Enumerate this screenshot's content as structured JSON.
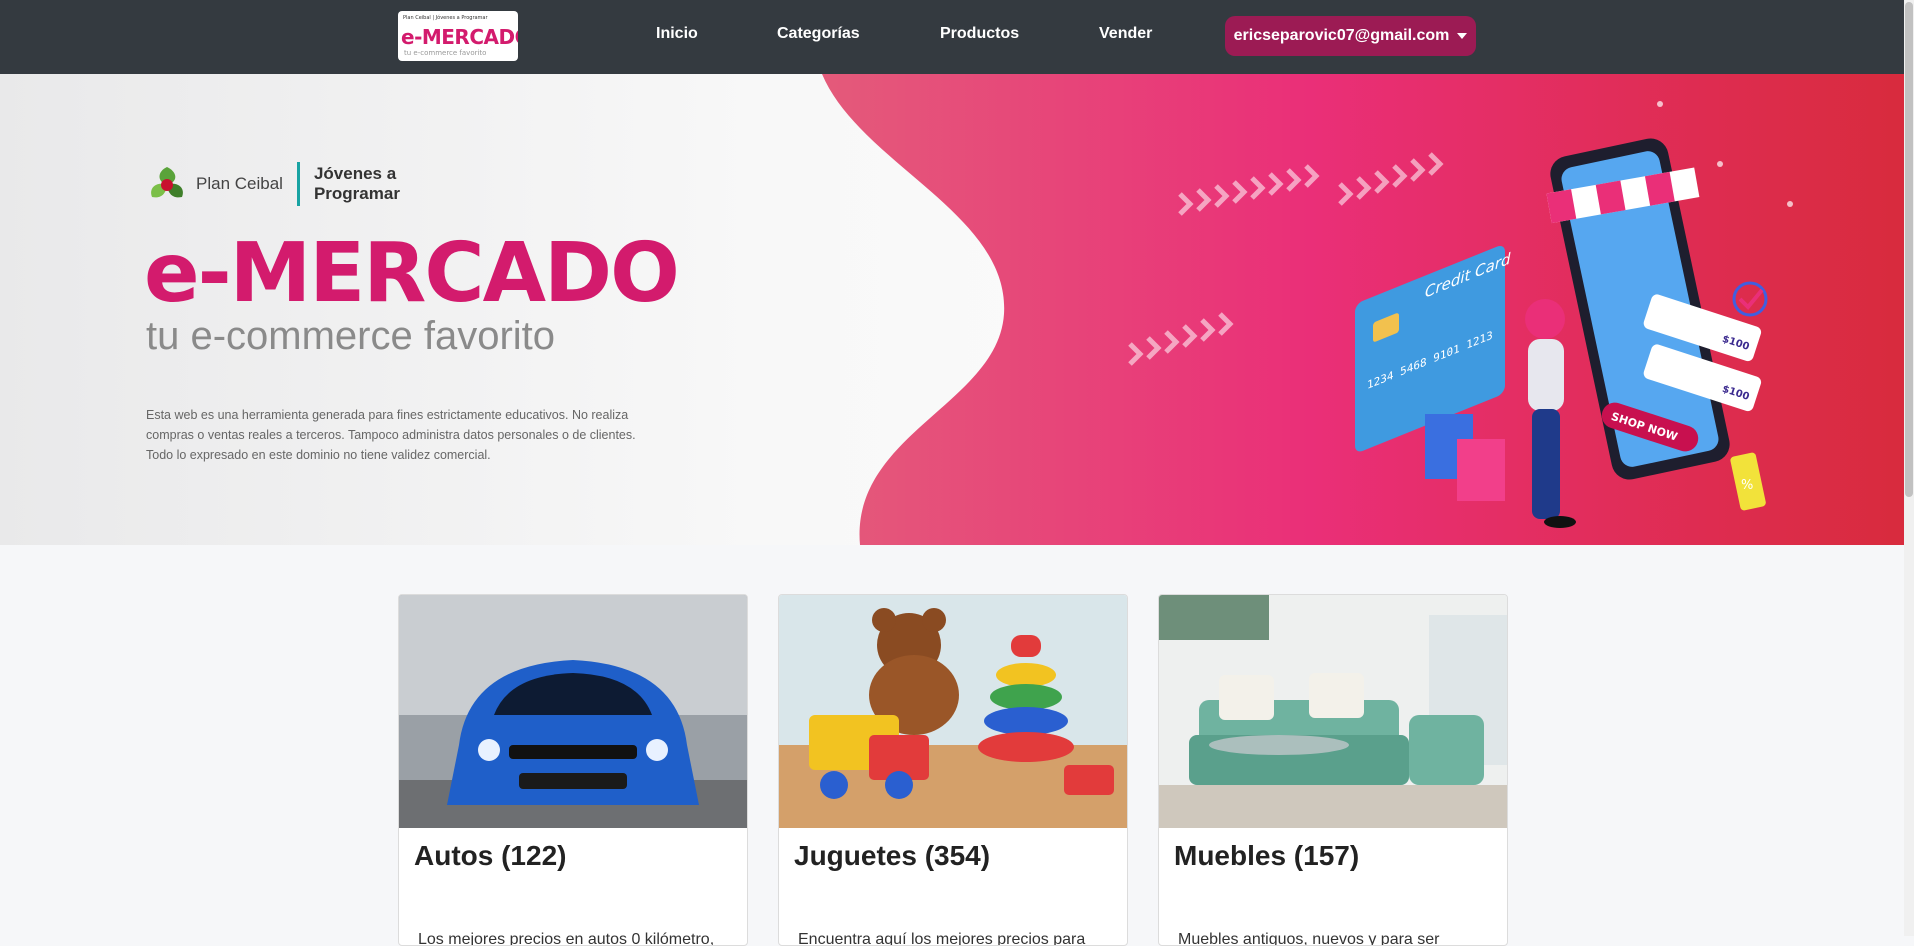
{
  "navbar": {
    "logo": {
      "top_small": "Plan Ceibal | Jóvenes a Programar",
      "title": "e-MERCADO",
      "tagline": "tu e-commerce favorito"
    },
    "links": [
      "Inicio",
      "Categorías",
      "Productos",
      "Vender"
    ],
    "user_email": "ericseparovic07@gmail.com"
  },
  "hero": {
    "org_name": "Plan Ceibal",
    "program_name": "Jóvenes a Programar",
    "title": "e-MERCADO",
    "subtitle": "tu e-commerce favorito",
    "disclaimer": "Esta web es una herramienta generada para fines estrictamente educativos. No realiza compras o ventas reales a terceros. Tampoco administra datos personales o de clientes. Todo lo expresado en este dominio no tiene validez comercial.",
    "illustration": {
      "card_label": "Credit Card",
      "card_number": "1234 5468 9101 1213",
      "price_tag_1": "$100",
      "price_tag_2": "$100",
      "shop_button": "SHOP NOW",
      "discount_tag": "%"
    }
  },
  "categories": [
    {
      "title": "Autos (122)",
      "description": "Los mejores precios en autos 0 kilómetro,"
    },
    {
      "title": "Juguetes (354)",
      "description": "Encuentra aquí los mejores precios para"
    },
    {
      "title": "Muebles (157)",
      "description": "Muebles antiguos, nuevos y para ser"
    }
  ],
  "colors": {
    "brand_pink": "#d31b6d",
    "navbar_bg": "#343a40",
    "user_button": "#9c1b54"
  }
}
